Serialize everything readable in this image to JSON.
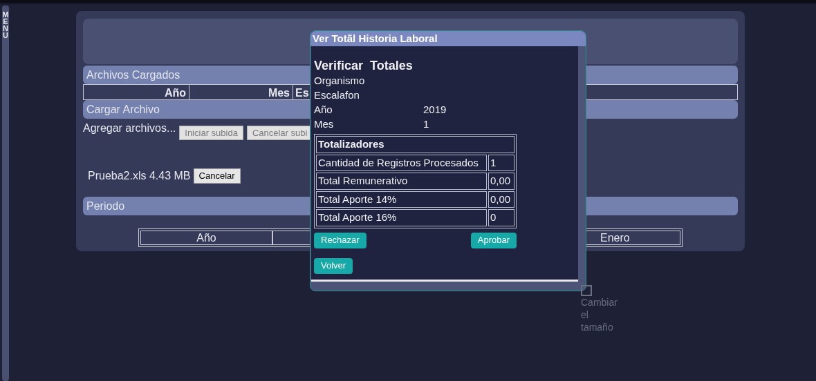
{
  "side_menu": {
    "letters": [
      "M",
      "E",
      "N",
      "U"
    ]
  },
  "sections": [
    {
      "title": "Archivos Cargados"
    },
    {
      "title": "Cargar Archivo"
    },
    {
      "title": "Periodo"
    }
  ],
  "files_table": {
    "columns": [
      "Año",
      "Mes",
      "Es"
    ]
  },
  "upload": {
    "add_label": "Agregar archivos...",
    "buttons": [
      {
        "label": "Iniciar subida",
        "disabled": true
      },
      {
        "label": "Cancelar subi",
        "disabled": true
      }
    ],
    "file": {
      "name": "Prueba2.xls",
      "size": "4.43 MB",
      "button": "Cancelar"
    }
  },
  "period_table": {
    "cells": [
      "Año",
      "Enero"
    ]
  },
  "dialog": {
    "title": "Ver Totãl Historia Laboral",
    "heading": "Verificar  Totales",
    "fields": [
      {
        "label": "Organismo"
      },
      {
        "label": "Escalafon"
      },
      {
        "label": "Año",
        "value": "2019"
      },
      {
        "label": "Mes",
        "value": "1"
      }
    ],
    "totals": {
      "title": "Totalizadores",
      "rows": [
        {
          "label": "Cantidad de Registros Procesados",
          "value": "1"
        },
        {
          "label": "Total Remunerativo",
          "value": "0,00"
        },
        {
          "label": "Total Aporte 14%",
          "value": "0,00"
        },
        {
          "label": "Total Aporte 16%",
          "value": "0"
        }
      ]
    },
    "buttons": {
      "reject": "Rechazar",
      "approve": "Aprobar",
      "back": "Volver"
    },
    "resize_label": "Cambiar el tamaño"
  }
}
